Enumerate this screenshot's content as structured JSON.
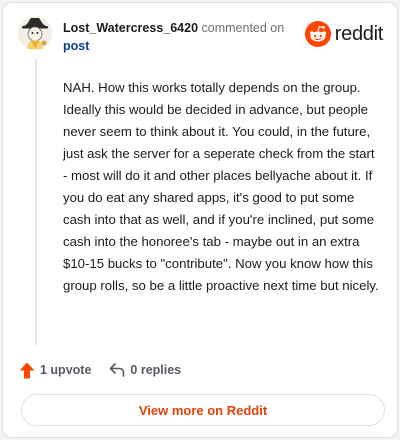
{
  "comment": {
    "username": "Lost_Watercress_6420",
    "action_text": "commented on",
    "post_link": "post",
    "body": "NAH. How this works totally depends on the group. Ideally this would be decided in advance, but people never seem to think about it. You could, in the future, just ask the server for a seperate check from the start - most will do it and other places bellyache about it. If you do eat any shared apps, it's good to put some cash into that as well, and if you're inclined, put some cash into the honoree's tab - maybe out in an extra $10-15 bucks to \"contribute\". Now you know how this group rolls, so be a little proactive next time but nicely."
  },
  "brand": {
    "wordmark": "reddit",
    "icon": "reddit-snoo-icon",
    "color": "#ff4500"
  },
  "footer": {
    "upvotes": "1 upvote",
    "replies": "0 replies",
    "view_more": "View more on Reddit"
  },
  "colors": {
    "accent": "#ff4500",
    "link": "#0f3d91"
  }
}
